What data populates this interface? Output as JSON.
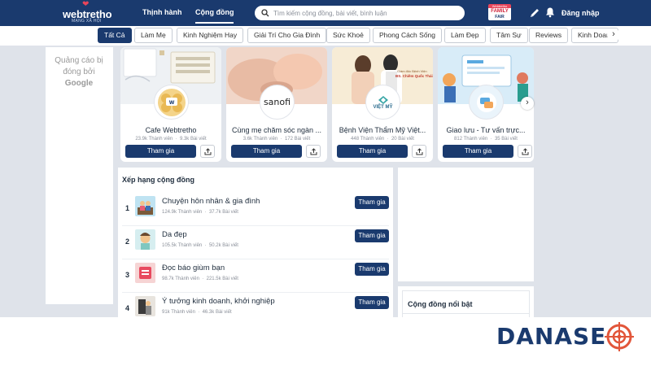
{
  "header": {
    "logo_text": "webtretho",
    "logo_sub": "MẠNG XÃ HỘI",
    "nav": [
      {
        "label": "Thịnh hành"
      },
      {
        "label": "Cộng đồng"
      }
    ],
    "search_placeholder": "Tìm kiếm cộng đồng, bài viết, bình luận",
    "fair_badge": {
      "top": "Webtretho",
      "main": "FAMILY",
      "bottom": "FAIR"
    },
    "login_label": "Đăng nhập"
  },
  "chips": [
    {
      "label": "Tất Cả",
      "active": true
    },
    {
      "label": "Làm Mẹ"
    },
    {
      "label": "Kinh Nghiệm Hay"
    },
    {
      "label": "Giải Trí Cho Gia Đình"
    },
    {
      "label": "Sức Khoẻ"
    },
    {
      "label": "Phong Cách Sống"
    },
    {
      "label": "Làm Đẹp"
    },
    {
      "label": "Tâm Sự"
    },
    {
      "label": "Reviews"
    },
    {
      "label": "Kinh Doanh"
    }
  ],
  "ad": {
    "text": "Quảng cáo bị đóng bởi",
    "brand": "Google"
  },
  "cards": [
    {
      "name": "Cafe Webtretho",
      "members": "23.9k Thành viên",
      "posts": "9.3k Bài viết",
      "join_label": "Tham gia",
      "logo": "Webtretho"
    },
    {
      "name": "Cùng mẹ chăm sóc ngàn ...",
      "members": "3.6k Thành viên",
      "posts": "172 Bài viết",
      "join_label": "Tham gia",
      "logo": "sanofi"
    },
    {
      "name": "Bệnh Viện Thẩm Mỹ Việt...",
      "members": "448 Thành viên",
      "posts": "20 Bài viết",
      "join_label": "Tham gia",
      "logo": "VIỆT MỸ",
      "img_caption_1": "Giám đốc Bệnh Viện",
      "img_caption_2": "BS. Chiêm Quốc Thái"
    },
    {
      "name": "Giao lưu - Tư vấn trực...",
      "members": "812 Thành viên",
      "posts": "35 Bài viết",
      "join_label": "Tham gia",
      "logo": ""
    }
  ],
  "ranking": {
    "title": "Xếp hạng cộng đồng",
    "items": [
      {
        "rank": "1",
        "name": "Chuyện hôn nhân & gia đình",
        "members": "124.9k Thành viên",
        "posts": "37.7k Bài viết",
        "join_label": "Tham gia"
      },
      {
        "rank": "2",
        "name": "Da đẹp",
        "members": "105.5k Thành viên",
        "posts": "50.2k Bài viết",
        "join_label": "Tham gia"
      },
      {
        "rank": "3",
        "name": "Đọc báo giùm bạn",
        "members": "98.7k Thành viên",
        "posts": "221.5k Bài viết",
        "join_label": "Tham gia"
      },
      {
        "rank": "4",
        "name": "Ý tưởng kinh doanh, khởi nghiệp",
        "members": "91k Thành viên",
        "posts": "46.3k Bài viết",
        "join_label": "Tham gia"
      }
    ]
  },
  "featured": {
    "title": "Cộng đồng nổi bật"
  },
  "watermark": {
    "text": "DANASE"
  },
  "colors": {
    "primary": "#1a3a6e",
    "accent": "#e8455a",
    "page_bg": "#dfe3ea"
  }
}
